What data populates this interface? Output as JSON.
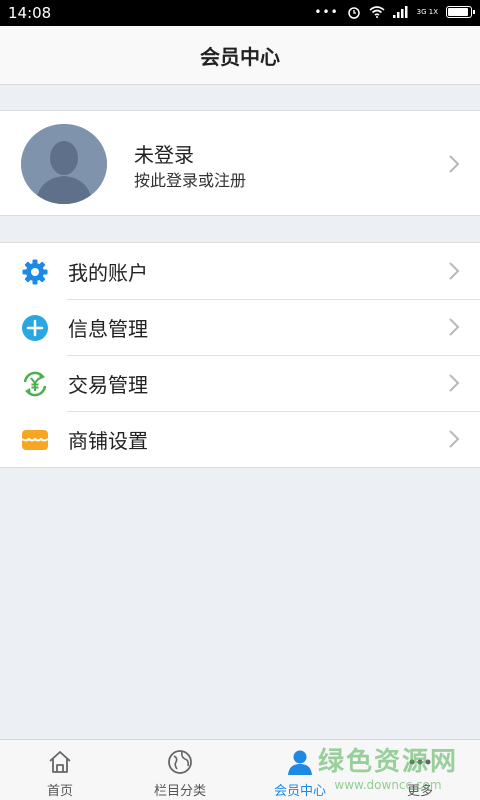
{
  "status_bar": {
    "time": "14:08",
    "network": "3G 1X",
    "battery_level": 0.9
  },
  "header": {
    "title": "会员中心"
  },
  "profile": {
    "name": "未登录",
    "subtitle": "按此登录或注册",
    "avatar_icon": "avatar-silhouette-icon"
  },
  "menu": {
    "items": [
      {
        "label": "我的账户",
        "icon": "gear-icon",
        "color": "#1e88e5"
      },
      {
        "label": "信息管理",
        "icon": "plus-circle-icon",
        "color": "#29a8e0"
      },
      {
        "label": "交易管理",
        "icon": "yuan-exchange-icon",
        "color": "#4caf50"
      },
      {
        "label": "商铺设置",
        "icon": "store-icon",
        "color": "#f5a623"
      }
    ]
  },
  "tab_bar": {
    "tabs": [
      {
        "label": "首页",
        "icon": "home-icon",
        "active": false
      },
      {
        "label": "栏目分类",
        "icon": "globe-icon",
        "active": false
      },
      {
        "label": "会员中心",
        "icon": "user-icon",
        "active": true
      },
      {
        "label": "更多",
        "icon": "more-icon",
        "active": false
      }
    ]
  },
  "colors": {
    "accent": "#1e88e5",
    "background": "#eceff3"
  },
  "watermark": {
    "main": "绿色资源网",
    "sub": "www.downcc.com"
  }
}
